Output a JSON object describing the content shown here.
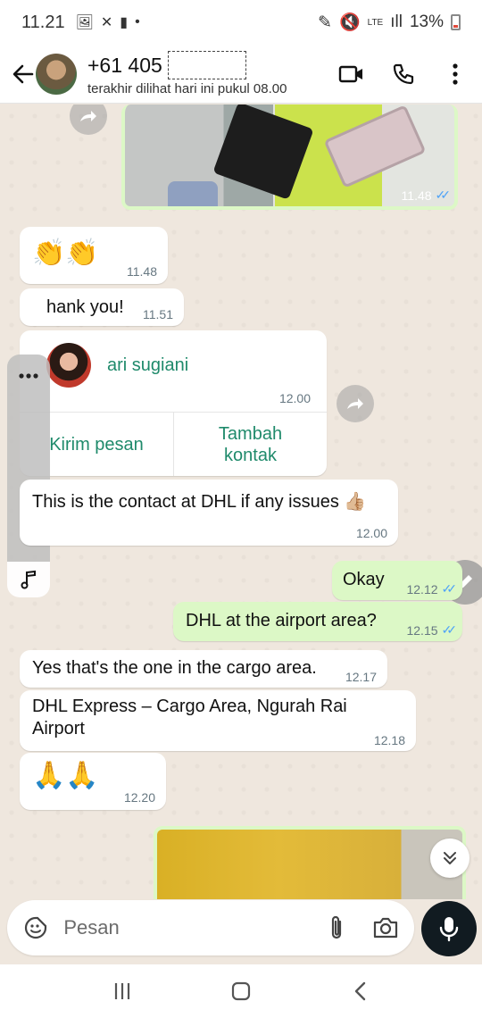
{
  "status_bar": {
    "time": "11.21",
    "network": "LTE",
    "battery": "13%",
    "icons": [
      "gallery-icon",
      "missed-call-icon",
      "sim-alert-icon",
      "dot-icon",
      "pen-icon",
      "mute-icon",
      "lte-icon",
      "signal-icon",
      "battery-icon"
    ]
  },
  "header": {
    "contact_name": "+61 405",
    "last_seen": "terakhir dilihat hari ini pukul 08.00",
    "icons": [
      "back-arrow-icon",
      "video-call-icon",
      "phone-call-icon",
      "more-options-icon"
    ]
  },
  "messages": [
    {
      "id": "m1",
      "direction": "out",
      "type": "image",
      "time": "11.48",
      "read": true
    },
    {
      "id": "m2",
      "direction": "in",
      "text": "👏👏",
      "time": "11.48"
    },
    {
      "id": "m3",
      "direction": "in",
      "text": "hank you!",
      "time": "11.51"
    },
    {
      "id": "m4",
      "direction": "in",
      "type": "contact",
      "contact_name": "ari sugiani",
      "time": "12.00",
      "actions": [
        "Kirim pesan",
        "Tambah kontak"
      ]
    },
    {
      "id": "m5",
      "direction": "in",
      "text": "This is the contact at DHL if any issues 👍🏼",
      "time": "12.00"
    },
    {
      "id": "m6",
      "direction": "out",
      "text": "Okay",
      "time": "12.12",
      "read": true
    },
    {
      "id": "m7",
      "direction": "out",
      "text": "DHL at the airport area?",
      "time": "12.15",
      "read": true
    },
    {
      "id": "m8",
      "direction": "in",
      "text": "Yes that's the one in the cargo area.",
      "time": "12.17"
    },
    {
      "id": "m9",
      "direction": "in",
      "text": "DHL Express – Cargo Area, Ngurah Rai Airport",
      "time": "12.18"
    },
    {
      "id": "m10",
      "direction": "in",
      "text": "🙏🙏",
      "time": "12.20"
    },
    {
      "id": "m11",
      "direction": "out",
      "type": "image"
    }
  ],
  "input": {
    "placeholder": "Pesan",
    "icons": [
      "emoji-sticker-icon",
      "attach-icon",
      "camera-icon",
      "mic-icon"
    ]
  },
  "colors": {
    "outgoing_bubble": "#dcf8c6",
    "incoming_bubble": "#ffffff",
    "chat_background": "#efe7de",
    "accent_green": "#1f8a6b",
    "read_ticks": "#4fa3f7"
  }
}
